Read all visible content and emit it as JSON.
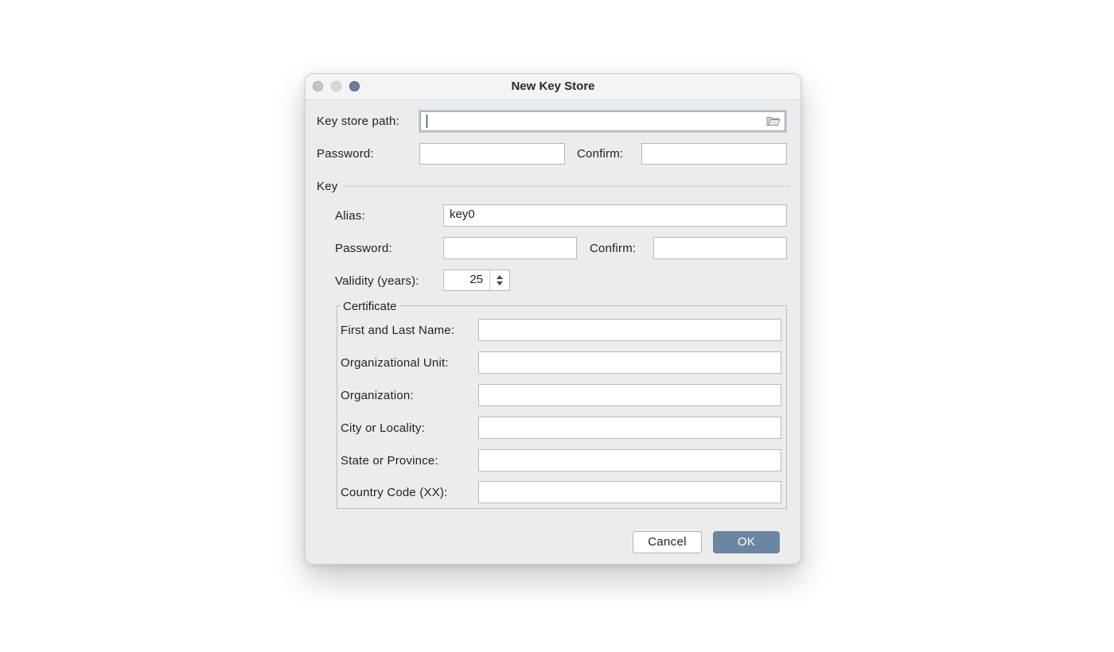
{
  "window": {
    "title": "New Key Store"
  },
  "keystore": {
    "path_label": "Key store path:",
    "path_value": "",
    "password_label": "Password:",
    "password_value": "",
    "confirm_label": "Confirm:",
    "confirm_value": ""
  },
  "key": {
    "section_label": "Key",
    "alias_label": "Alias:",
    "alias_value": "key0",
    "password_label": "Password:",
    "password_value": "",
    "confirm_label": "Confirm:",
    "confirm_value": "",
    "validity_label": "Validity (years):",
    "validity_value": "25"
  },
  "certificate": {
    "title": "Certificate",
    "fields": [
      {
        "label": "First and Last Name:",
        "value": ""
      },
      {
        "label": "Organizational Unit:",
        "value": ""
      },
      {
        "label": "Organization:",
        "value": ""
      },
      {
        "label": "City or Locality:",
        "value": ""
      },
      {
        "label": "State or Province:",
        "value": ""
      },
      {
        "label": "Country Code (XX):",
        "value": ""
      }
    ]
  },
  "buttons": {
    "cancel": "Cancel",
    "ok": "OK"
  },
  "icons": {
    "browse": "folder-icon",
    "spinner": "stepper-arrows-icon"
  },
  "colors": {
    "accent": "#6a86a2",
    "zoom_button": "#6c7f98"
  }
}
